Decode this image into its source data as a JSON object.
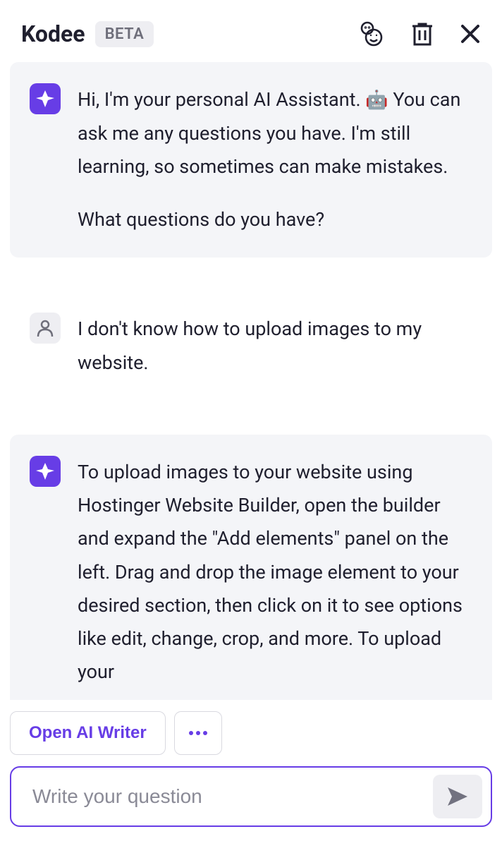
{
  "header": {
    "title": "Kodee",
    "badge": "BETA"
  },
  "messages": {
    "bot1": {
      "part1a": "Hi, I'm your personal AI Assistant. ",
      "part1b": " You can ask me any questions you have. I'm still learning, so sometimes can make mistakes.",
      "p2": "What questions do you have?"
    },
    "user1": "I don't know how to upload images to my website.",
    "bot2": "To upload images to your website using Hostinger Website Builder, open the builder and expand the \"Add elements\" panel on the left. Drag and drop the image element to your desired section, then click on it to see options like edit, change, crop, and more. To upload your"
  },
  "footer": {
    "open_ai_writer": "Open AI Writer",
    "placeholder": "Write your question"
  }
}
